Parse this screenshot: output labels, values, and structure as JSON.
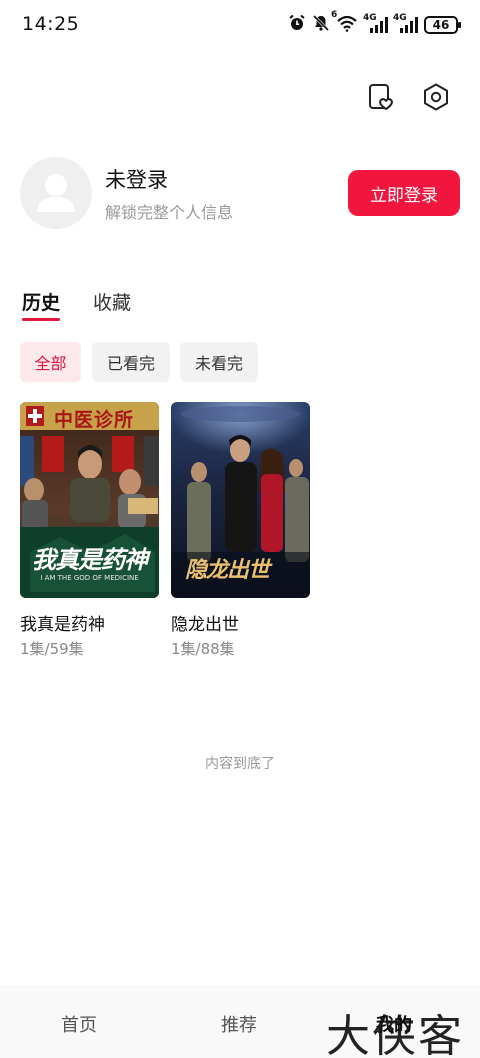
{
  "status_bar": {
    "time": "14:25",
    "signal_label_1": "4G",
    "signal_label_2": "4G",
    "wifi_badge": "6",
    "battery": "46"
  },
  "header": {
    "icons": [
      "favorites-icon",
      "settings-icon"
    ]
  },
  "profile": {
    "name": "未登录",
    "subtitle": "解锁完整个人信息",
    "login_label": "立即登录"
  },
  "tabs": [
    {
      "label": "历史",
      "active": true
    },
    {
      "label": "收藏",
      "active": false
    }
  ],
  "filters": [
    {
      "label": "全部",
      "active": true
    },
    {
      "label": "已看完",
      "active": false
    },
    {
      "label": "未看完",
      "active": false
    }
  ],
  "history": [
    {
      "title": "我真是药神",
      "progress": "1集/59集",
      "poster_sign": "中医诊所",
      "poster_title": "我真是药神",
      "poster_subtitle": "I AM THE GOD OF MEDICINE"
    },
    {
      "title": "隐龙出世",
      "progress": "1集/88集",
      "poster_title": "隐龙出世"
    }
  ],
  "end_text": "内容到底了",
  "bottom_nav": [
    {
      "label": "首页",
      "active": false
    },
    {
      "label": "推荐",
      "active": false
    },
    {
      "label": "我的",
      "active": true
    }
  ],
  "watermark": "大侠客",
  "colors": {
    "accent": "#f2163f",
    "chip_active_bg": "#fde8ec",
    "chip_bg": "#f2f2f2",
    "muted_text": "#9a9a9a"
  }
}
